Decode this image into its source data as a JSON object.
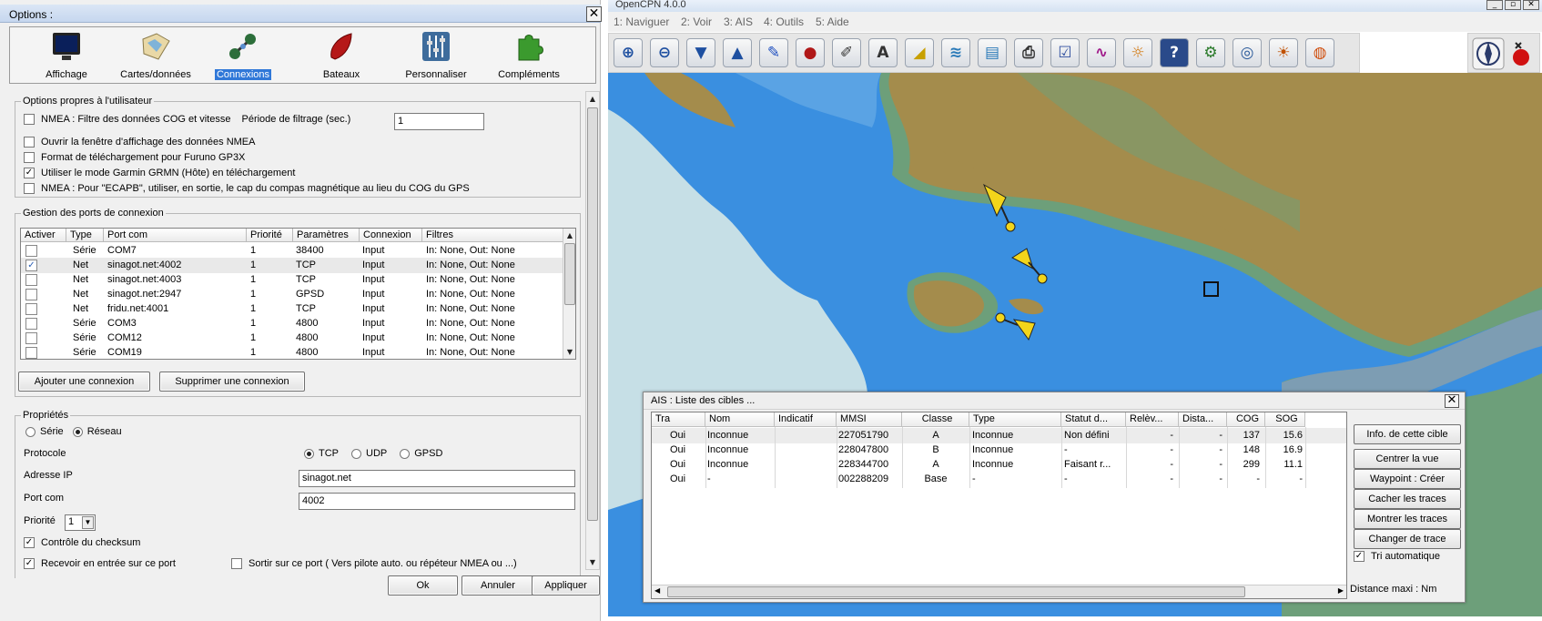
{
  "options": {
    "title": "Options :",
    "close_glyph": "✕",
    "categories": [
      {
        "label": "Affichage",
        "icon": "monitor-icon"
      },
      {
        "label": "Cartes/données",
        "icon": "charts-icon"
      },
      {
        "label": "Connexions",
        "icon": "connections-icon",
        "selected": true
      },
      {
        "label": "Bateaux",
        "icon": "ships-icon"
      },
      {
        "label": "Personnaliser",
        "icon": "sliders-icon"
      },
      {
        "label": "Compléments",
        "icon": "plugins-icon"
      }
    ],
    "user_options": {
      "legend": "Options propres à l'utilisateur",
      "nmea_filter_label": "NMEA : Filtre des données COG et vitesse",
      "filter_period_label": "Période de filtrage (sec.)",
      "filter_period_value": "1",
      "open_nmea_window": "Ouvrir la fenêtre d'affichage des données NMEA",
      "furuno_format": "Format de téléchargement pour Furuno GP3X",
      "garmin_mode": "Utiliser le mode Garmin GRMN (Hôte) en téléchargement",
      "ecapb_option": "NMEA : Pour \"ECAPB\", utiliser, en sortie, le cap du compas magnétique  au lieu du COG du GPS"
    },
    "ports": {
      "legend": "Gestion des ports de connexion",
      "columns": [
        "Activer",
        "Type",
        "Port com",
        "Priorité",
        "Paramètres",
        "Connexion",
        "Filtres"
      ],
      "rows": [
        {
          "enabled": false,
          "type": "Série",
          "port": "COM7",
          "priority": "1",
          "params": "38400",
          "connection": "Input",
          "filters": "In: None, Out: None"
        },
        {
          "enabled": true,
          "type": "Net",
          "port": "sinagot.net:4002",
          "priority": "1",
          "params": "TCP",
          "connection": "Input",
          "filters": "In: None, Out: None"
        },
        {
          "enabled": false,
          "type": "Net",
          "port": "sinagot.net:4003",
          "priority": "1",
          "params": "TCP",
          "connection": "Input",
          "filters": "In: None, Out: None"
        },
        {
          "enabled": false,
          "type": "Net",
          "port": "sinagot.net:2947",
          "priority": "1",
          "params": "GPSD",
          "connection": "Input",
          "filters": "In: None, Out: None"
        },
        {
          "enabled": false,
          "type": "Net",
          "port": "fridu.net:4001",
          "priority": "1",
          "params": "TCP",
          "connection": "Input",
          "filters": "In: None, Out: None"
        },
        {
          "enabled": false,
          "type": "Série",
          "port": "COM3",
          "priority": "1",
          "params": "4800",
          "connection": "Input",
          "filters": "In: None, Out: None"
        },
        {
          "enabled": false,
          "type": "Série",
          "port": "COM12",
          "priority": "1",
          "params": "4800",
          "connection": "Input",
          "filters": "In: None, Out: None"
        },
        {
          "enabled": false,
          "type": "Série",
          "port": "COM19",
          "priority": "1",
          "params": "4800",
          "connection": "Input",
          "filters": "In: None, Out: None"
        }
      ],
      "add_button": "Ajouter une connexion",
      "remove_button": "Supprimer une connexion"
    },
    "properties": {
      "legend": "Propriétés",
      "serial_label": "Série",
      "network_label": "Réseau",
      "protocol_label": "Protocole",
      "tcp_label": "TCP",
      "udp_label": "UDP",
      "gpsd_label": "GPSD",
      "ip_label": "Adresse IP",
      "ip_value": "sinagot.net",
      "port_label": "Port com",
      "port_value": "4002",
      "priority_label": "Priorité",
      "priority_value": "1",
      "checksum_label": "Contrôle du checksum",
      "receive_label": "Recevoir en entrée sur ce port",
      "output_label": "Sortir sur ce port ( Vers pilote auto. ou répéteur NMEA ou ...)"
    },
    "ok_button": "Ok",
    "cancel_button": "Annuler",
    "apply_button": "Appliquer"
  },
  "cpn": {
    "title": "OpenCPN 4.0.0",
    "menu": [
      "1: Naviguer",
      "2: Voir",
      "3: AIS",
      "4: Outils",
      "5: Aide"
    ],
    "toolbar_icons": [
      "zoom-in-icon",
      "zoom-out-icon",
      "scale-down-icon",
      "scale-up-icon",
      "route-icon",
      "boat-follow-icon",
      "settings-icon",
      "text-icon",
      "tide-icon",
      "current-icon",
      "layers-icon",
      "print-icon",
      "route-manager-icon",
      "track-icon",
      "color-scheme-icon",
      "help-icon",
      "plugin-icon",
      "radar-icon",
      "weather-icon",
      "mob-icon"
    ],
    "toolbar_glyphs": [
      "⊕",
      "⊖",
      "▼",
      "▲",
      "✎",
      "●",
      "✐",
      "A",
      "◢",
      "≋",
      "▤",
      "⎙",
      "☑",
      "∿",
      "☼",
      "?",
      "⚙",
      "◎",
      "☀",
      "◍"
    ]
  },
  "ais": {
    "title": "AIS : Liste des cibles ...",
    "close_glyph": "✕",
    "columns": [
      "Tra",
      "Nom",
      "Indicatif",
      "MMSI",
      "Classe",
      "Type",
      "Statut d...",
      "Relèv...",
      "Dista...",
      "COG",
      "SOG"
    ],
    "rows": [
      {
        "tra": "Oui",
        "nom": "Inconnue",
        "indicatif": "",
        "mmsi": "227051790",
        "classe": "A",
        "type": "Inconnue",
        "statut": "Non défini",
        "relev": "-",
        "dist": "-",
        "cog": "137",
        "sog": "15.6"
      },
      {
        "tra": "Oui",
        "nom": "Inconnue",
        "indicatif": "",
        "mmsi": "228047800",
        "classe": "B",
        "type": "Inconnue",
        "statut": "-",
        "relev": "-",
        "dist": "-",
        "cog": "148",
        "sog": "16.9"
      },
      {
        "tra": "Oui",
        "nom": "Inconnue",
        "indicatif": "",
        "mmsi": "228344700",
        "classe": "A",
        "type": "Inconnue",
        "statut": "Faisant r...",
        "relev": "-",
        "dist": "-",
        "cog": "299",
        "sog": "11.1"
      },
      {
        "tra": "Oui",
        "nom": "-",
        "indicatif": "",
        "mmsi": "002288209",
        "classe": "Base",
        "type": "-",
        "statut": "-",
        "relev": "-",
        "dist": "-",
        "cog": "-",
        "sog": "-"
      }
    ],
    "buttons": {
      "info": "Info. de cette cible",
      "center": "Centrer la vue",
      "waypoint": "Waypoint : Créer",
      "hide_tracks": "Cacher les traces",
      "show_tracks": "Montrer les traces",
      "change_track": "Changer de trace"
    },
    "auto_sort_label": "Tri automatique",
    "max_distance_label": "Distance maxi : Nm"
  }
}
